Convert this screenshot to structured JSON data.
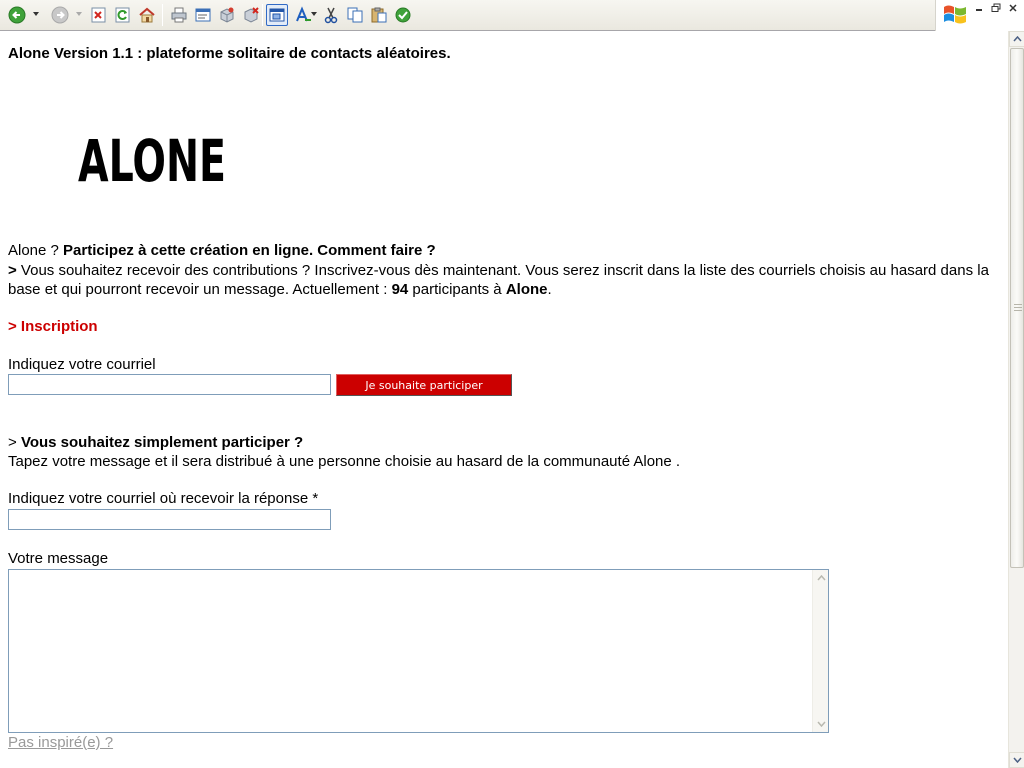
{
  "toolbar": {
    "buttons": [
      {
        "name": "back-button",
        "icon": "back-arrow-icon"
      },
      {
        "name": "forward-button",
        "icon": "forward-arrow-icon"
      },
      {
        "name": "stop-button",
        "icon": "stop-icon"
      },
      {
        "name": "refresh-button",
        "icon": "refresh-icon"
      },
      {
        "name": "home-button",
        "icon": "home-icon"
      },
      {
        "name": "print-button",
        "icon": "printer-icon"
      },
      {
        "name": "edit-button",
        "icon": "edit-page-icon"
      },
      {
        "name": "package-button",
        "icon": "package-icon"
      },
      {
        "name": "package-delete-button",
        "icon": "package-delete-icon"
      },
      {
        "name": "new-window-button",
        "icon": "new-window-icon"
      },
      {
        "name": "font-size-button",
        "icon": "font-size-icon"
      },
      {
        "name": "cut-button",
        "icon": "scissors-icon"
      },
      {
        "name": "copy-button",
        "icon": "copy-icon"
      },
      {
        "name": "paste-button",
        "icon": "paste-icon"
      },
      {
        "name": "go-button",
        "icon": "go-icon"
      }
    ],
    "colors": {
      "accent": "#316ac5",
      "back_green": "#3fa23a"
    }
  },
  "page": {
    "heading": "Alone Version 1.1 : plateforme solitaire de contacts aléatoires.",
    "logo_text": "ALONE",
    "intro_prefix": "Alone ? ",
    "intro_bold": "Participez à cette création en ligne. Comment faire ?",
    "para_marker": ">",
    "para_text_1": " Vous souhaitez recevoir des contributions ? Inscrivez-vous dès maintenant. Vous serez inscrit dans la liste des courriels choisis au hasard dans la base et qui pourront recevoir un message. Actuellement : ",
    "participant_count": "94",
    "para_text_2": " participants à ",
    "para_brand": "Alone",
    "para_end": ".",
    "inscription_title": "> Inscription",
    "email_label": "Indiquez votre courriel",
    "email_value": "",
    "participate_button": "Je souhaite participer",
    "simple_prefix": "> ",
    "simple_bold": "Vous souhaitez simplement participer ?",
    "simple_desc": "Tapez votre message et il sera distribué à une personne choisie au hasard de la communauté Alone .",
    "reply_label": "Indiquez votre courriel où recevoir la réponse *",
    "reply_value": "",
    "message_label": "Votre message",
    "message_value": "",
    "not_inspired_link": "Pas inspiré(e) ?"
  },
  "colors": {
    "accent_red": "#cc0000",
    "link_gray": "#999999",
    "input_border": "#7f9db9"
  }
}
